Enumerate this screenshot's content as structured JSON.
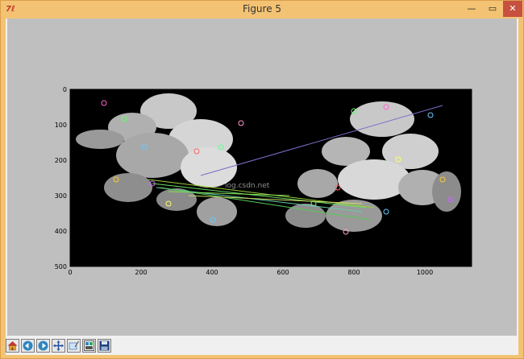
{
  "window": {
    "title": "Figure 5",
    "app_icon": "tk-feather-icon"
  },
  "controls": {
    "minimize": "—",
    "maximize": "▭",
    "close": "✕"
  },
  "plot": {
    "xticks": [
      "0",
      "200",
      "400",
      "600",
      "800",
      "1000"
    ],
    "yticks": [
      "0",
      "100",
      "200",
      "300",
      "400",
      "500"
    ],
    "watermark": "log.csdn.net"
  },
  "toolbar": [
    {
      "name": "home-button",
      "icon": "home-icon"
    },
    {
      "name": "back-button",
      "icon": "back-arrow-icon"
    },
    {
      "name": "forward-button",
      "icon": "forward-arrow-icon"
    },
    {
      "name": "pan-button",
      "icon": "pan-cross-icon"
    },
    {
      "name": "zoom-button",
      "icon": "zoom-rect-icon"
    },
    {
      "name": "subplots-button",
      "icon": "subplots-icon"
    },
    {
      "name": "save-button",
      "icon": "save-disk-icon"
    }
  ],
  "colors": {
    "titlebar": "#f3c373",
    "figure_bg": "#bfbfbf",
    "close_btn": "#c7503f"
  }
}
